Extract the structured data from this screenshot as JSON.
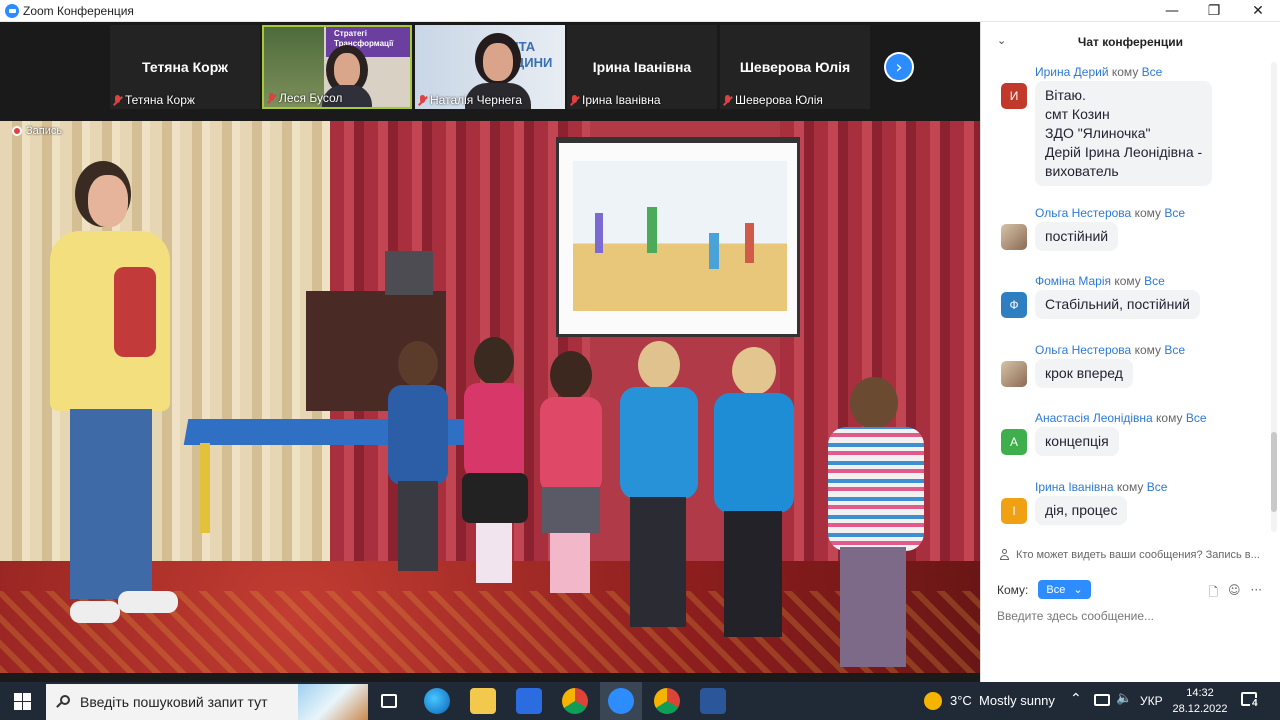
{
  "window": {
    "title": "Zoom Конференция"
  },
  "gallery": {
    "tiles": [
      {
        "display_name": "Тетяна Корж",
        "label": "Тетяна Корж"
      },
      {
        "display_name": "",
        "label": "Леся Бусол",
        "bg_text": "Стратегі\nТрансформації"
      },
      {
        "display_name": "",
        "label": "Наталія Чернега",
        "bg_text": "ІТА\nДИНИ"
      },
      {
        "display_name": "Ірина Іванівна",
        "label": "Ірина Іванівна"
      },
      {
        "display_name": "Шеверова Юлія",
        "label": "Шеверова Юлія"
      }
    ]
  },
  "recording": {
    "label": "Запись"
  },
  "chat": {
    "title": "Чат конференции",
    "to_word": "кому",
    "messages": [
      {
        "sender": "Ирина Дерий",
        "to": "Все",
        "avatar_letter": "И",
        "avatar_color": "#c0392b",
        "text": "Вітаю.\nсмт Козин\nЗДО \"Ялиночка\"\nДерій Ірина Леонідівна -\nвихователь"
      },
      {
        "sender": "Ольга Нестерова",
        "to": "Все",
        "avatar_letter": "",
        "avatar_color": "#8a6a52",
        "text": "постійний"
      },
      {
        "sender": "Фоміна Марія",
        "to": "Все",
        "avatar_letter": "Ф",
        "avatar_color": "#2d7fc1",
        "text": "Стабільний, постійний"
      },
      {
        "sender": "Ольга Нестерова",
        "to": "Все",
        "avatar_letter": "",
        "avatar_color": "#8a6a52",
        "text": "крок вперед"
      },
      {
        "sender": "Анастасія Леонідівна",
        "to": "Все",
        "avatar_letter": "А",
        "avatar_color": "#3fae4c",
        "text": "концепція"
      },
      {
        "sender": "Ірина Іванівна",
        "to": "Все",
        "avatar_letter": "І",
        "avatar_color": "#f0a013",
        "text": "дія, процес"
      }
    ],
    "privacy_text": "Кто может видеть ваши сообщения? Запись в...",
    "to_label": "Кому:",
    "to_value": "Все",
    "input_placeholder": "Введите здесь сообщение..."
  },
  "taskbar": {
    "search_placeholder": "Введіть пошуковий запит тут",
    "weather": "3°C  Mostly sunny",
    "language": "УКР",
    "time": "14:32",
    "date": "28.12.2022",
    "notifications": "4"
  }
}
